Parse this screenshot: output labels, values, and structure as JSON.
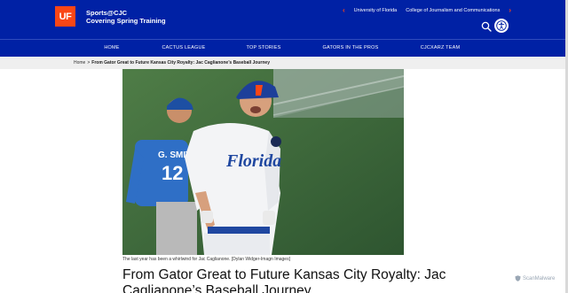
{
  "header": {
    "logo_text": "UF",
    "site_title": "Sports@CJC",
    "site_subtitle": "Covering Spring Training",
    "util_links": [
      "University of Florida",
      "College of Journalism and Communications"
    ]
  },
  "nav": {
    "items": [
      "HOME",
      "CACTUS LEAGUE",
      "TOP STORIES",
      "GATORS IN THE PROS",
      "CJCXARZ TEAM"
    ]
  },
  "breadcrumb": {
    "home": "Home",
    "separator": ">",
    "current": "From Gator Great to Future Kansas City Royalty: Jac Caglianone’s Baseball Journey"
  },
  "article": {
    "image_caption": "The last year has been a whirlwind for Jac Caglianone. [Dylan Widger-Imagn Images]",
    "headline": "From Gator Great to Future Kansas City Royalty: Jac Caglianone’s Baseball Journey",
    "jersey_front_text": "Florida",
    "jersey_back_name": "G. SMITH",
    "jersey_back_number": "12"
  },
  "watermark": {
    "text": "ScanMalware"
  },
  "colors": {
    "brand_blue": "#0021a5",
    "brand_orange": "#fa4616"
  }
}
